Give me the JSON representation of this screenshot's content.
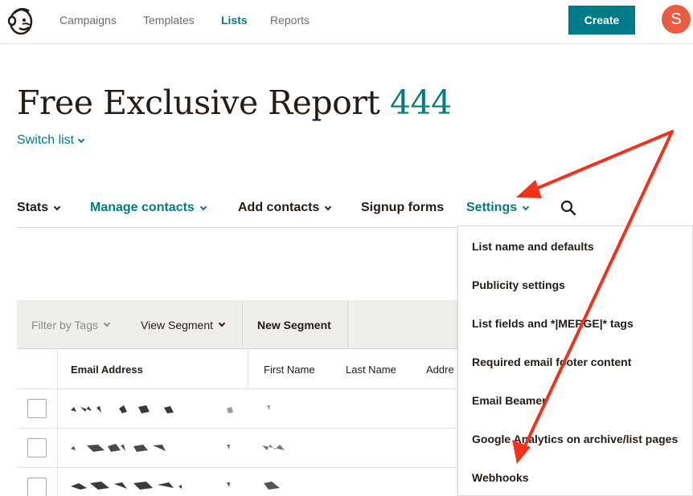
{
  "topnav": {
    "links": [
      {
        "label": "Campaigns",
        "active": false
      },
      {
        "label": "Templates",
        "active": false
      },
      {
        "label": "Lists",
        "active": true
      },
      {
        "label": "Reports",
        "active": false
      }
    ],
    "create_label": "Create",
    "avatar_initial": "S"
  },
  "header": {
    "title": "Free Exclusive Report",
    "title_count": "444",
    "switch_list_label": "Switch list"
  },
  "subnav": {
    "items": [
      {
        "label": "Stats",
        "has_chevron": true
      },
      {
        "label": "Manage contacts",
        "has_chevron": true
      },
      {
        "label": "Add contacts",
        "has_chevron": true
      },
      {
        "label": "Signup forms",
        "has_chevron": false
      },
      {
        "label": "Settings",
        "has_chevron": true
      }
    ],
    "search_icon": "search-icon"
  },
  "toolbar": {
    "filter_label": "Filter by Tags",
    "view_segment_label": "View Segment",
    "new_segment_label": "New Segment"
  },
  "table": {
    "columns": [
      "Email Address",
      "First Name",
      "Last Name",
      "Addre"
    ]
  },
  "settings_menu": {
    "items": [
      "List name and defaults",
      "Publicity settings",
      "List fields and *|MERGE|* tags",
      "Required email footer content",
      "Email Beamer",
      "Google Analytics on archive/list pages",
      "Webhooks"
    ]
  },
  "colors": {
    "accent": "#007c89",
    "avatar": "#e85c41",
    "annotation_arrow": "#f2321b"
  }
}
